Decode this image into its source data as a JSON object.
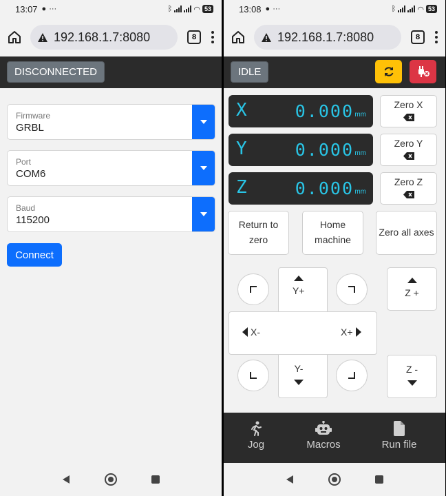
{
  "left": {
    "status_bar": {
      "time": "13:07",
      "battery": "53"
    },
    "url_bar": {
      "url": "192.168.1.7:8080",
      "tab_count": "8"
    },
    "state_badge": "DISCONNECTED",
    "fields": [
      {
        "label": "Firmware",
        "value": "GRBL"
      },
      {
        "label": "Port",
        "value": "COM6"
      },
      {
        "label": "Baud",
        "value": "115200"
      }
    ],
    "connect_label": "Connect"
  },
  "right": {
    "status_bar": {
      "time": "13:08",
      "battery": "53"
    },
    "url_bar": {
      "url": "192.168.1.7:8080",
      "tab_count": "8"
    },
    "state_badge": "IDLE",
    "dro": [
      {
        "axis": "X",
        "value": "0.000",
        "unit": "mm",
        "zero_label": "Zero X"
      },
      {
        "axis": "Y",
        "value": "0.000",
        "unit": "mm",
        "zero_label": "Zero Y"
      },
      {
        "axis": "Z",
        "value": "0.000",
        "unit": "mm",
        "zero_label": "Zero Z"
      }
    ],
    "actions": {
      "return_line1": "Return to",
      "return_line2": "zero",
      "home_line1": "Home",
      "home_line2": "machine",
      "zero_all": "Zero all axes"
    },
    "jog": {
      "y_plus": "Y+",
      "y_minus": "Y-",
      "x_minus": "X-",
      "x_plus": "X+",
      "z_plus": "Z +",
      "z_minus": "Z -"
    },
    "nav": {
      "jog": "Jog",
      "macros": "Macros",
      "run_file": "Run file"
    }
  },
  "colors": {
    "primary": "#0d6efd",
    "dark_bar": "#2b2b2b",
    "dro_text": "#29c5e6",
    "badge_gray": "#6c757d",
    "refresh_yellow": "#ffc107",
    "disconnect_red": "#dc3545"
  },
  "icons": [
    "home-icon",
    "warning-icon",
    "tabs-icon",
    "more-icon",
    "chevron-down-icon",
    "refresh-icon",
    "unplug-icon",
    "backspace-icon",
    "triangle-up-icon",
    "triangle-down-icon",
    "triangle-left-icon",
    "triangle-right-icon",
    "corner-icon",
    "walk-icon",
    "robot-icon",
    "file-icon",
    "back-icon",
    "circle-home-icon",
    "recents-icon"
  ]
}
